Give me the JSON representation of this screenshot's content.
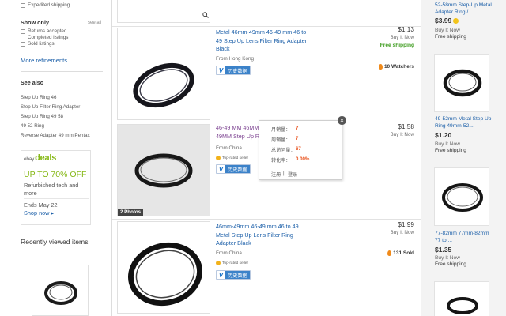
{
  "sidebar": {
    "top_filter": "Expedited shipping",
    "show_only": {
      "heading": "Show only",
      "see_all": "see all",
      "items": [
        "Returns accepted",
        "Completed listings",
        "Sold listings"
      ]
    },
    "more_refinements": "More refinements...",
    "see_also": {
      "heading": "See also",
      "items": [
        "Step Up Ring 46",
        "Step Up Filter Ring Adapter",
        "Step Up Ring 49 58",
        "49 52 Ring",
        "Reverse Adapter 49 mm Pentax"
      ]
    },
    "deals": {
      "logo_prefix": "ebay",
      "logo": "deals",
      "headline": "UP TO 70% OFF",
      "subtitle": "Refurbished tech and more",
      "ends": "Ends May 22",
      "shop_now": "Shop now ▸"
    },
    "recently_viewed": "Recently viewed items"
  },
  "listings": [
    {
      "title": "Metal 46mm-49mm 46-49 mm 46 to 49 Step Up Lens Filter Ring Adapter Black",
      "from": "From Hong Kong",
      "badge": "历史数据",
      "price": "$1.13",
      "format": "Buy It Now",
      "shipping": "Free shipping",
      "hotness": "10 Watchers"
    },
    {
      "title": "46-49 MM 46MM-49MM 46MM-49MM Step Up Ring Filter",
      "from": "From China",
      "seller_badge": "Top-rated seller",
      "badge": "历史数据",
      "price": "$1.58",
      "format": "Buy It Now",
      "photos": "2 Photos"
    },
    {
      "title": "46mm-49mm 46-49 mm 46 to 49 Metal Step Up Lens Filter Ring Adapter Black",
      "from": "From China",
      "seller_badge": "Top-rated seller",
      "badge": "历史数据",
      "price": "$1.99",
      "format": "Buy It Now",
      "hotness": "131 Sold"
    }
  ],
  "popup": {
    "close": "×",
    "rows": [
      {
        "label": "月销量：",
        "value": "7",
        "color": "#e8501a"
      },
      {
        "label": "周销量：",
        "value": "7",
        "color": "#e8501a"
      },
      {
        "label": "总访问量：",
        "value": "67",
        "color": "#e8501a"
      },
      {
        "label": "转化率：",
        "value": "0.00%",
        "color": "#e8501a"
      }
    ],
    "register": "注册",
    "separator": "|",
    "login": "登录"
  },
  "right_column": {
    "top": {
      "title": "52-58mm Step-Up Metal Adapter Ring / ...",
      "price": "$3.99",
      "format": "Buy It Now",
      "shipping": "Free shipping"
    },
    "items": [
      {
        "title": "49-52mm Metal Step Up Ring 49mm-52...",
        "price": "$1.20",
        "format": "Buy It Now",
        "shipping": "Free shipping"
      },
      {
        "title": "77-82mm 77mm-82mm 77 to ...",
        "price": "$1.35",
        "format": "Buy It Now",
        "shipping": "Free shipping"
      }
    ]
  },
  "colors": {
    "link": "#1a5ea8",
    "visited": "#7a3f8f",
    "free_shipping": "#3a9a1a",
    "deals_green": "#86b817",
    "badge_blue": "#3b82c9"
  }
}
